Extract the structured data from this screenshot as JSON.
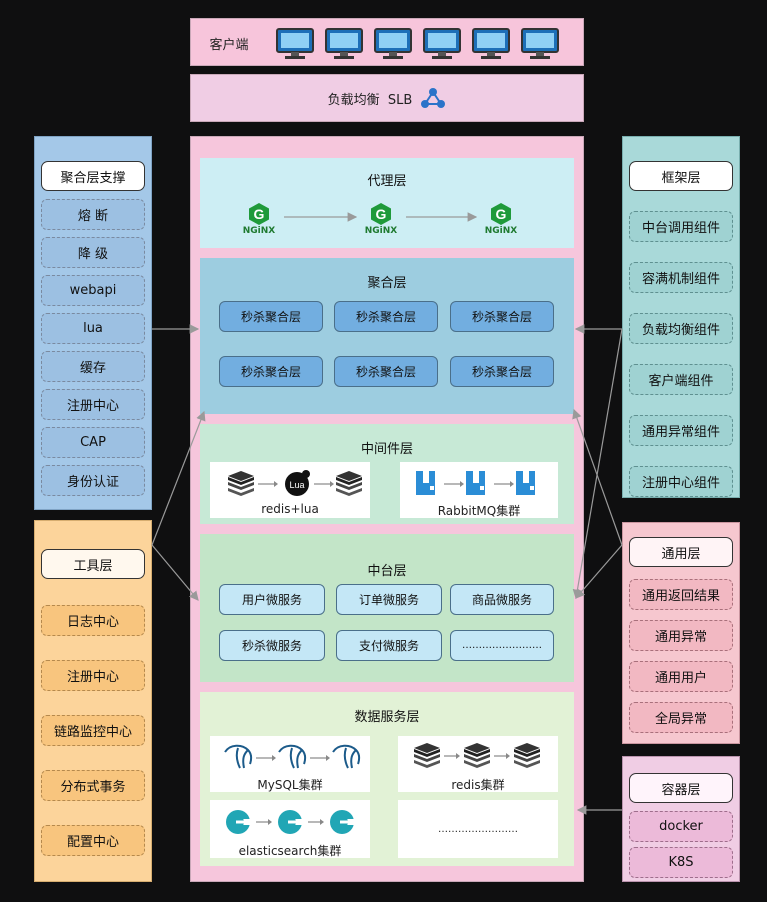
{
  "client": {
    "label": "客户端"
  },
  "slb": {
    "label": "负载均衡  SLB"
  },
  "proxy": {
    "title": "代理层",
    "logo_text": "NGiNX"
  },
  "aggregation": {
    "title": "聚合层",
    "cells": [
      "秒杀聚合层",
      "秒杀聚合层",
      "秒杀聚合层",
      "秒杀聚合层",
      "秒杀聚合层",
      "秒杀聚合层"
    ]
  },
  "middleware": {
    "title": "中间件层",
    "redis_lua": "redis+lua",
    "lua_text": "Lua",
    "rabbitmq": "RabbitMQ集群"
  },
  "platform": {
    "title": "中台层",
    "cells": [
      "用户微服务",
      "订单微服务",
      "商品微服务",
      "秒杀微服务",
      "支付微服务",
      "……………………"
    ]
  },
  "data": {
    "title": "数据服务层",
    "mysql": "MySQL集群",
    "redis": "redis集群",
    "es": "elasticsearch集群",
    "more": "……………………"
  },
  "left_support": {
    "header": "聚合层支撑",
    "items": [
      "熔 断",
      "降 级",
      "webapi",
      "lua",
      "缓存",
      "注册中心",
      "CAP",
      "身份认证"
    ]
  },
  "left_tools": {
    "header": "工具层",
    "items": [
      "日志中心",
      "注册中心",
      "链路监控中心",
      "分布式事务",
      "配置中心"
    ]
  },
  "right_framework": {
    "header": "框架层",
    "items": [
      "中台调用组件",
      "容满机制组件",
      "负载均衡组件",
      "客户端组件",
      "通用异常组件",
      "注册中心组件"
    ]
  },
  "right_common": {
    "header": "通用层",
    "items": [
      "通用返回结果",
      "通用异常",
      "通用用户",
      "全局异常"
    ]
  },
  "right_container": {
    "header": "容器层",
    "items": [
      "docker",
      "K8S"
    ]
  },
  "colors": {
    "pink": "#f6c6dc",
    "lightpink": "#f0cde4",
    "blue": "#a4c8e8",
    "orange": "#fcd49b",
    "teal": "#a9d9d9",
    "rose": "#f6c7cf"
  }
}
